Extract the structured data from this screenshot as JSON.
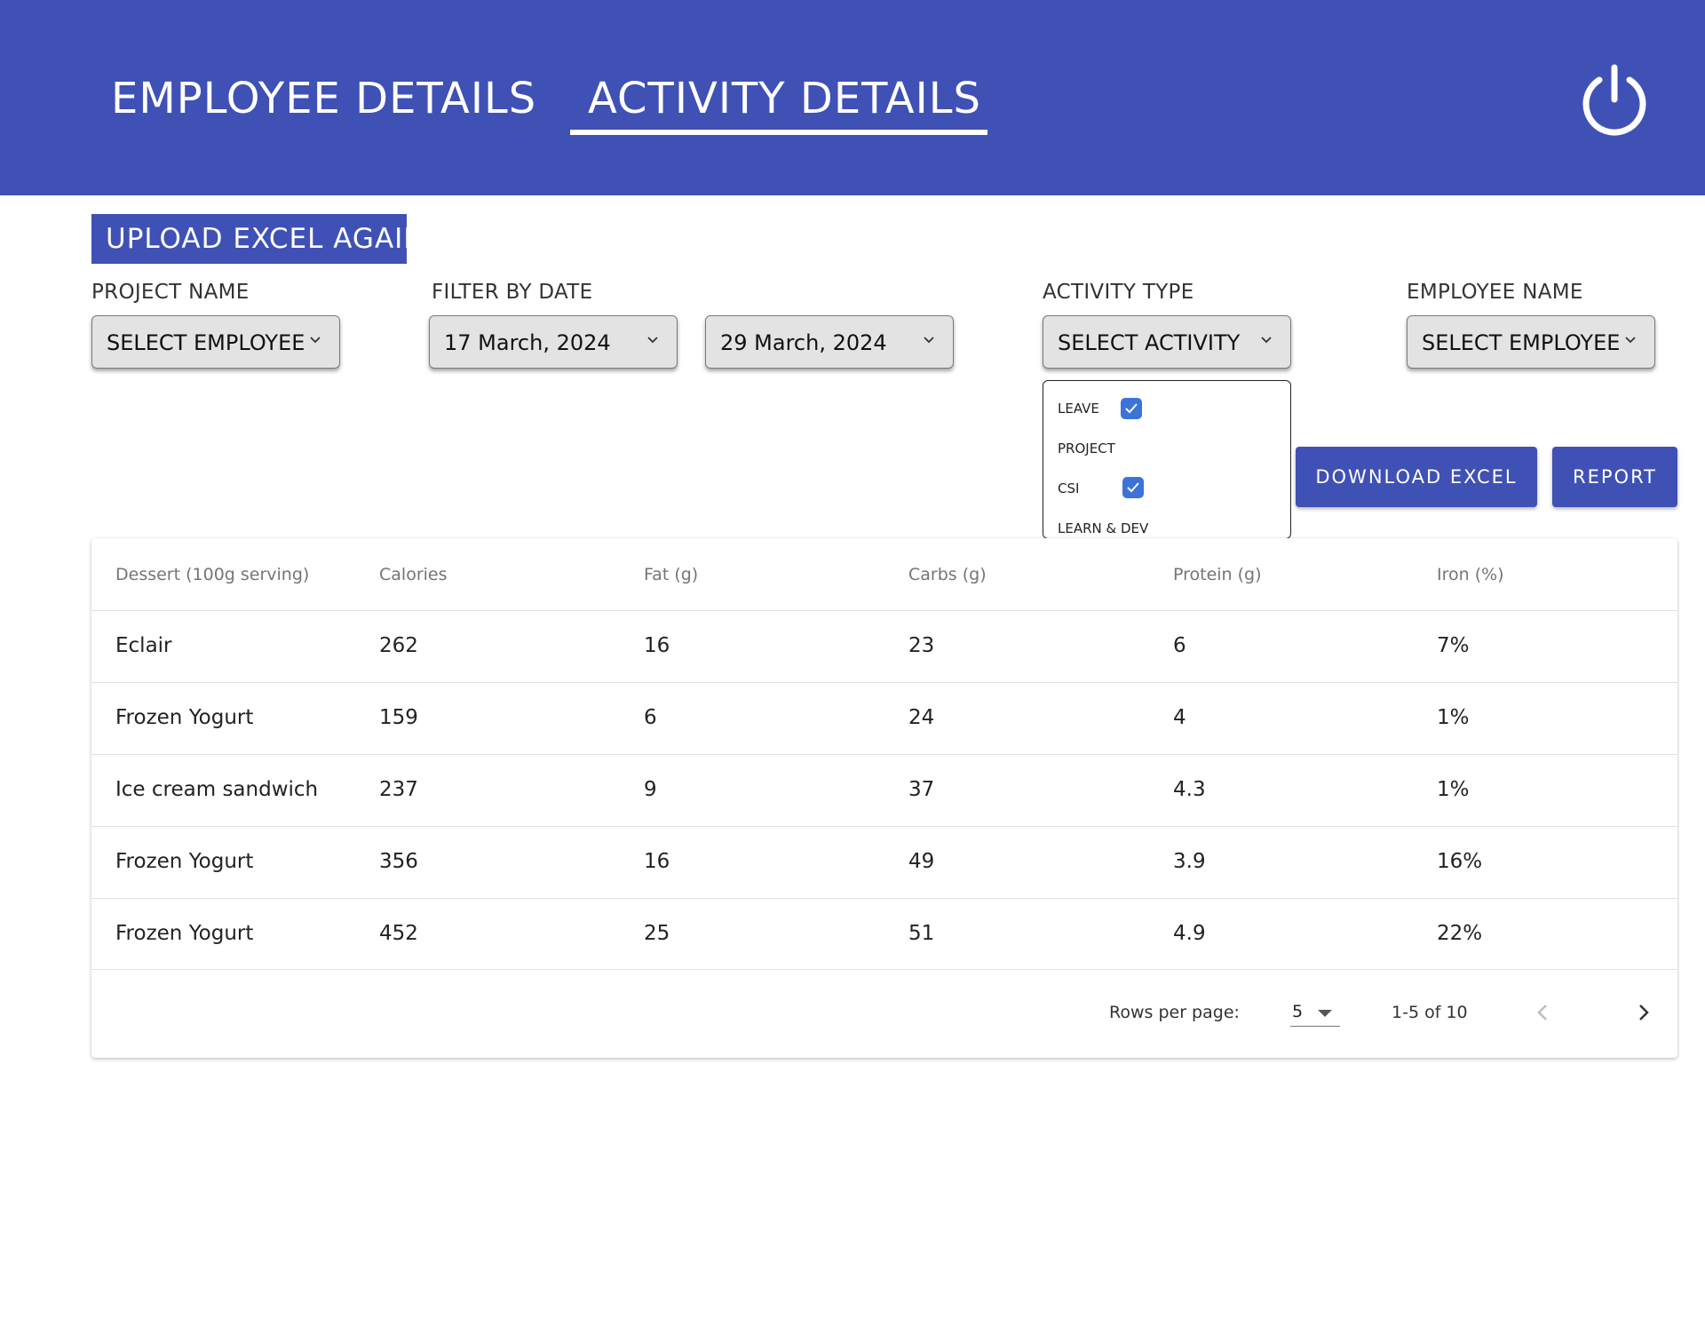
{
  "header": {
    "tabs": [
      {
        "label": "EMPLOYEE DETAILS",
        "active": false
      },
      {
        "label": "ACTIVITY DETAILS",
        "active": true
      }
    ],
    "power_icon": "power-icon",
    "background": "#3f51b5"
  },
  "upload_button": "UPLOAD EXCEL AGAIN",
  "filters": {
    "project": {
      "label": "PROJECT NAME",
      "value": "SELECT EMPLOYEE",
      "ghost": "SELECT"
    },
    "date": {
      "label": "FILTER BY DATE",
      "from": "17 March, 2024",
      "to": "29 March, 2024"
    },
    "activity": {
      "label": "ACTIVITY TYPE",
      "value": "SELECT ACTIVITY",
      "options": [
        {
          "label": "LEAVE",
          "checked": true
        },
        {
          "label": "PROJECT",
          "checked": false
        },
        {
          "label": "CSI",
          "checked": true
        },
        {
          "label": "LEARN & DEV",
          "checked": false
        }
      ]
    },
    "employee": {
      "label": "EMPLOYEE NAME",
      "value": "SELECT EMPLOYEE"
    }
  },
  "actions": {
    "download": "DOWNLOAD EXCEL",
    "report": "REPORT"
  },
  "table": {
    "columns": [
      "Dessert (100g serving)",
      "Calories",
      "Fat (g)",
      "Carbs (g)",
      "Protein (g)",
      "Iron (%)"
    ],
    "rows": [
      [
        "Eclair",
        "262",
        "16",
        "23",
        "6",
        "7%"
      ],
      [
        "Frozen Yogurt",
        "159",
        "6",
        "24",
        "4",
        "1%"
      ],
      [
        "Ice cream sandwich",
        "237",
        "9",
        "37",
        "4.3",
        "1%"
      ],
      [
        "Frozen Yogurt",
        "356",
        "16",
        "49",
        "3.9",
        "16%"
      ],
      [
        "Frozen Yogurt",
        "452",
        "25",
        "51",
        "4.9",
        "22%"
      ]
    ]
  },
  "pagination": {
    "rows_per_page_label": "Rows per page:",
    "rows_per_page": "5",
    "range": "1-5 of 10"
  },
  "colors": {
    "primary": "#3f51b5",
    "checkbox": "#3b73d9"
  }
}
